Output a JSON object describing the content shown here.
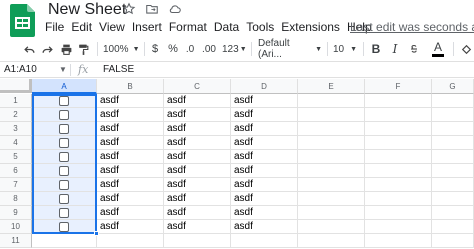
{
  "app": {
    "title": "New Sheet",
    "last_edit": "Last edit was seconds ago"
  },
  "menu": [
    "File",
    "Edit",
    "View",
    "Insert",
    "Format",
    "Data",
    "Tools",
    "Extensions",
    "Help"
  ],
  "toolbar": {
    "zoom": "100%",
    "currency": "$",
    "percent": "%",
    "decrease_decimals": ".0",
    "increase_decimals": ".00",
    "more_formats": "123",
    "font": "Default (Ari...",
    "font_size": "10",
    "text_color_glyph": "A"
  },
  "formula_bar": {
    "name_box": "A1:A10",
    "fx": "fx",
    "value": "FALSE"
  },
  "grid": {
    "columns": [
      "A",
      "B",
      "C",
      "D",
      "E",
      "F",
      "G"
    ],
    "rows": [
      {
        "n": "1",
        "b": "asdf",
        "c": "asdf",
        "d": "asdf"
      },
      {
        "n": "2",
        "b": "asdf",
        "c": "asdf",
        "d": "asdf"
      },
      {
        "n": "3",
        "b": "asdf",
        "c": "asdf",
        "d": "asdf"
      },
      {
        "n": "4",
        "b": "asdf",
        "c": "asdf",
        "d": "asdf"
      },
      {
        "n": "5",
        "b": "asdf",
        "c": "asdf",
        "d": "asdf"
      },
      {
        "n": "6",
        "b": "asdf",
        "c": "asdf",
        "d": "asdf"
      },
      {
        "n": "7",
        "b": "asdf",
        "c": "asdf",
        "d": "asdf"
      },
      {
        "n": "8",
        "b": "asdf",
        "c": "asdf",
        "d": "asdf"
      },
      {
        "n": "9",
        "b": "asdf",
        "c": "asdf",
        "d": "asdf"
      },
      {
        "n": "10",
        "b": "asdf",
        "c": "asdf",
        "d": "asdf"
      }
    ],
    "extra_row": "11"
  },
  "colors": {
    "accent": "#1a73e8",
    "sheets_green": "#0f9d58",
    "selection_fill": "#e8f0fe"
  }
}
